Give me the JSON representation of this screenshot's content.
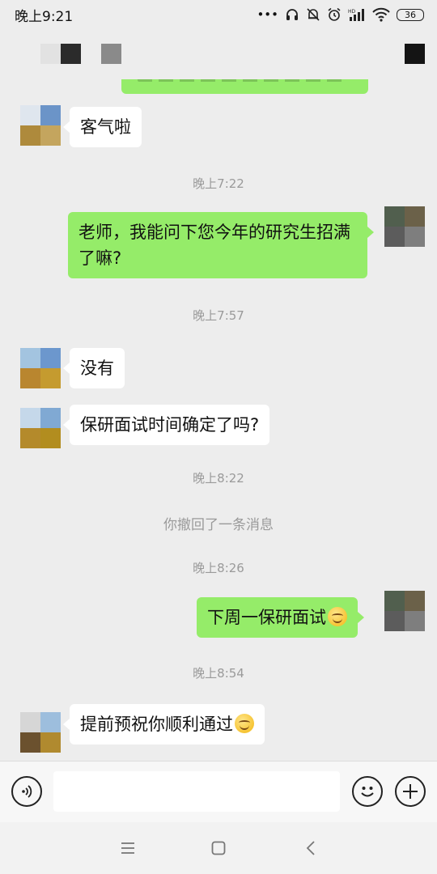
{
  "status_bar": {
    "time": "晚上9:21",
    "dots": "•••",
    "battery": "36",
    "icons": [
      "headphones-icon",
      "mute-bell-icon",
      "alarm-icon",
      "hd-signal-icon",
      "wifi-icon",
      "battery-icon"
    ]
  },
  "header": {
    "title_obscured": true
  },
  "colors": {
    "background": "#ededed",
    "outgoing_bubble": "#95ec69",
    "incoming_bubble": "#ffffff",
    "timestamp": "#9a9a9a"
  },
  "messages": [
    {
      "type": "incoming",
      "text": "客气啦"
    },
    {
      "type": "time",
      "text": "晚上7:22"
    },
    {
      "type": "outgoing",
      "text": "老师，我能问下您今年的研究生招满了嘛?"
    },
    {
      "type": "time",
      "text": "晚上7:57"
    },
    {
      "type": "incoming",
      "text": "没有"
    },
    {
      "type": "incoming",
      "text": "保研面试时间确定了吗?"
    },
    {
      "type": "time",
      "text": "晚上8:22"
    },
    {
      "type": "system",
      "text": "你撤回了一条消息"
    },
    {
      "type": "time",
      "text": "晚上8:26"
    },
    {
      "type": "outgoing",
      "text": "下周一保研面试",
      "emoji": "smile-emoji"
    },
    {
      "type": "time",
      "text": "晚上8:54"
    },
    {
      "type": "incoming",
      "text": "提前预祝你顺利通过",
      "emoji": "smile-emoji"
    }
  ],
  "input_bar": {
    "voice_icon": "voice-icon",
    "input_value": "",
    "emoji_icon": "emoji-icon",
    "plus_icon": "plus-icon"
  },
  "nav_bar": {
    "icons": [
      "menu-icon",
      "home-icon",
      "back-icon"
    ]
  }
}
